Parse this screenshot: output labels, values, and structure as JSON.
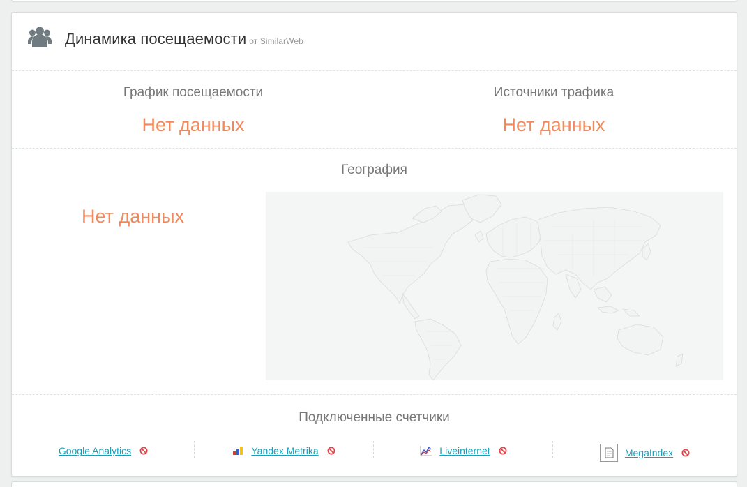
{
  "header": {
    "title": "Динамика посещаемости",
    "source": "от SimilarWeb",
    "icon": "users-icon"
  },
  "traffic_chart": {
    "label": "График посещаемости",
    "status": "Нет данных"
  },
  "traffic_sources": {
    "label": "Источники трафика",
    "status": "Нет данных"
  },
  "geography": {
    "label": "География",
    "status": "Нет данных"
  },
  "counters": {
    "label": "Подключенные счетчики",
    "items": [
      {
        "name": "Google Analytics",
        "icon": "",
        "status_icon": "ban-icon"
      },
      {
        "name": "Yandex Metrika",
        "icon": "yandex-metrika-icon",
        "status_icon": "ban-icon"
      },
      {
        "name": "Liveinternet",
        "icon": "liveinternet-icon",
        "status_icon": "ban-icon"
      },
      {
        "name": "MegaIndex",
        "icon": "megaindex-icon",
        "status_icon": "ban-icon"
      }
    ]
  },
  "colors": {
    "no_data": "#f08a5d",
    "link": "#1aa0b8",
    "ban": "#e0454a",
    "map_bg": "#f4f5f5"
  }
}
